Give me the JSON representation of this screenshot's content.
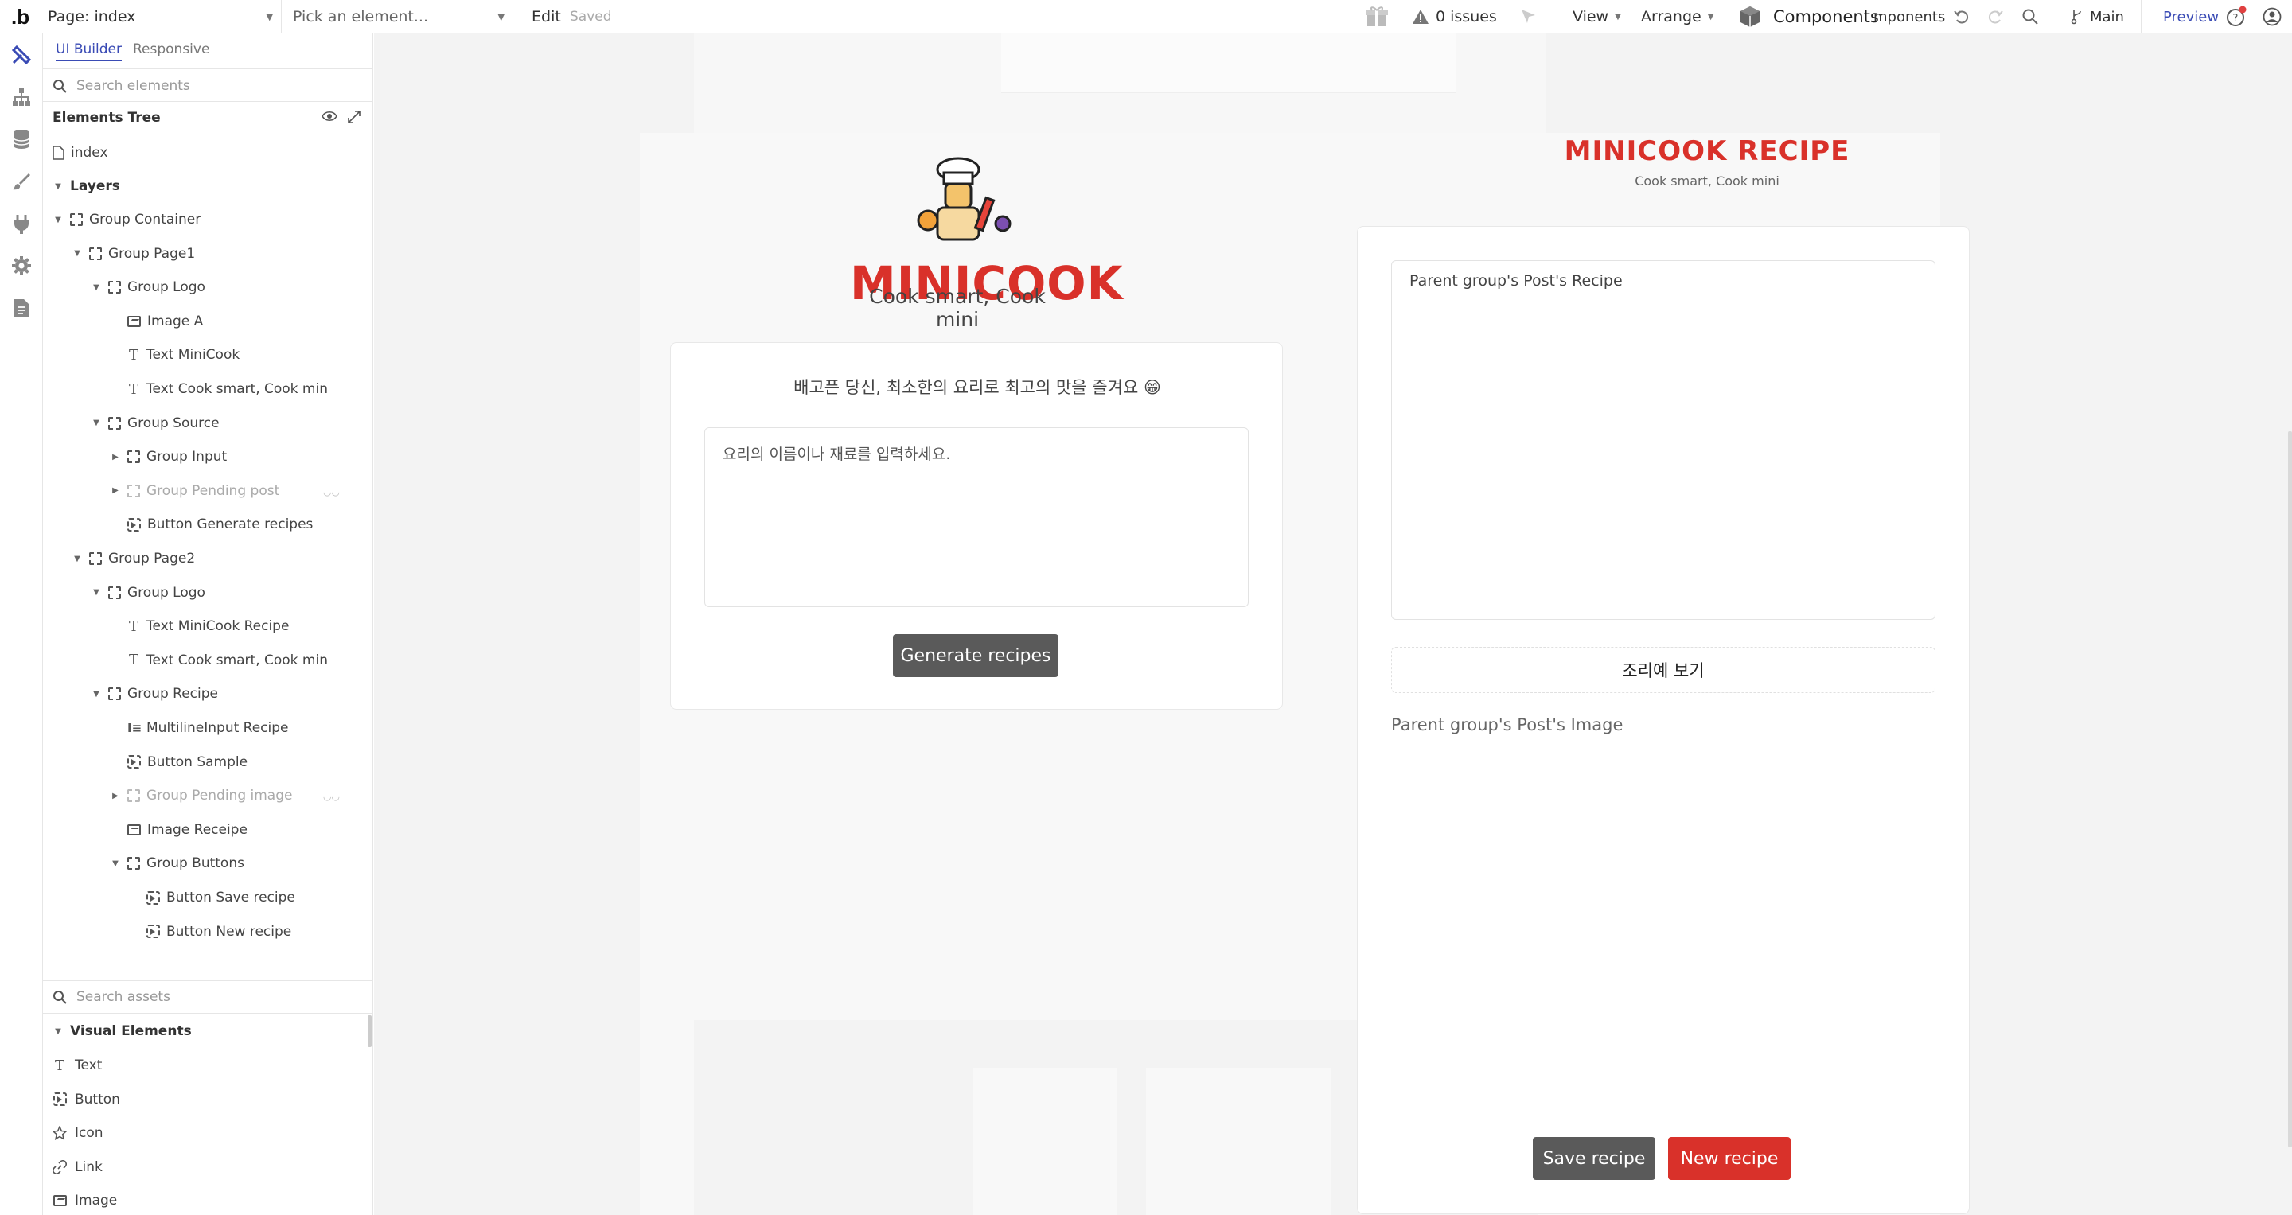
{
  "topbar": {
    "page_select": "Page: index",
    "element_select": "Pick an element...",
    "edit": "Edit",
    "saved": "Saved",
    "issues": "0 issues",
    "view": "View",
    "arrange": "Arrange",
    "components": "Components",
    "components_partial": "mponents",
    "branch": "Main",
    "preview": "Preview"
  },
  "panel": {
    "tab_ui_builder": "UI Builder",
    "tab_responsive": "Responsive",
    "search_placeholder": "Search elements",
    "tree_title": "Elements Tree",
    "page_name": "index",
    "layers_label": "Layers",
    "tree": [
      {
        "label": "Group Container",
        "type": "group",
        "depth": 0,
        "caret": "down"
      },
      {
        "label": "Group Page1",
        "type": "group",
        "depth": 1,
        "caret": "down"
      },
      {
        "label": "Group Logo",
        "type": "group",
        "depth": 2,
        "caret": "down"
      },
      {
        "label": "Image A",
        "type": "image",
        "depth": 3,
        "caret": ""
      },
      {
        "label": "Text MiniCook",
        "type": "text",
        "depth": 3,
        "caret": ""
      },
      {
        "label": "Text Cook smart, Cook min",
        "type": "text",
        "depth": 3,
        "caret": ""
      },
      {
        "label": "Group Source",
        "type": "group",
        "depth": 2,
        "caret": "down"
      },
      {
        "label": "Group Input",
        "type": "group",
        "depth": 3,
        "caret": "right"
      },
      {
        "label": "Group Pending post",
        "type": "group",
        "depth": 3,
        "caret": "right",
        "hidden": true
      },
      {
        "label": "Button Generate recipes",
        "type": "button",
        "depth": 3,
        "caret": ""
      },
      {
        "label": "Group Page2",
        "type": "group",
        "depth": 1,
        "caret": "down"
      },
      {
        "label": "Group Logo",
        "type": "group",
        "depth": 2,
        "caret": "down"
      },
      {
        "label": "Text MiniCook Recipe",
        "type": "text",
        "depth": 3,
        "caret": ""
      },
      {
        "label": "Text Cook smart, Cook min",
        "type": "text",
        "depth": 3,
        "caret": ""
      },
      {
        "label": "Group Recipe",
        "type": "group",
        "depth": 2,
        "caret": "down"
      },
      {
        "label": "MultilineInput Recipe",
        "type": "multi",
        "depth": 3,
        "caret": ""
      },
      {
        "label": "Button Sample",
        "type": "button",
        "depth": 3,
        "caret": ""
      },
      {
        "label": "Group Pending image",
        "type": "group",
        "depth": 3,
        "caret": "right",
        "hidden": true
      },
      {
        "label": "Image Receipe",
        "type": "image",
        "depth": 3,
        "caret": ""
      },
      {
        "label": "Group Buttons",
        "type": "group",
        "depth": 3,
        "caret": "down"
      },
      {
        "label": "Button Save recipe",
        "type": "button",
        "depth": 4,
        "caret": ""
      },
      {
        "label": "Button New recipe",
        "type": "button",
        "depth": 4,
        "caret": ""
      }
    ],
    "assets_placeholder": "Search assets",
    "visual_elements_label": "Visual Elements",
    "assets": [
      {
        "label": "Text",
        "icon": "text-icon"
      },
      {
        "label": "Button",
        "icon": "button-icon"
      },
      {
        "label": "Icon",
        "icon": "star-icon"
      },
      {
        "label": "Link",
        "icon": "link-icon"
      },
      {
        "label": "Image",
        "icon": "image-icon"
      }
    ]
  },
  "page1": {
    "logo_text": "MINICOOK",
    "tagline": "Cook smart, Cook mini",
    "prompt": "배고픈 당신, 최소한의 요리로 최고의 맛을 즐겨요 😁",
    "input_placeholder": "요리의 이름이나 재료를 입력하세요.",
    "generate_button": "Generate recipes"
  },
  "page2": {
    "logo_text": "MINICOOK RECIPE",
    "tagline": "Cook smart, Cook mini",
    "recipe_placeholder": "Parent group's Post's Recipe",
    "sample_button": "조리예 보기",
    "image_placeholder": "Parent group's Post's Image",
    "save_button": "Save recipe",
    "new_button": "New recipe"
  },
  "colors": {
    "accent": "#d9312a",
    "brand_blue": "#3a4bb5",
    "dark_button": "#5a5a5a"
  }
}
